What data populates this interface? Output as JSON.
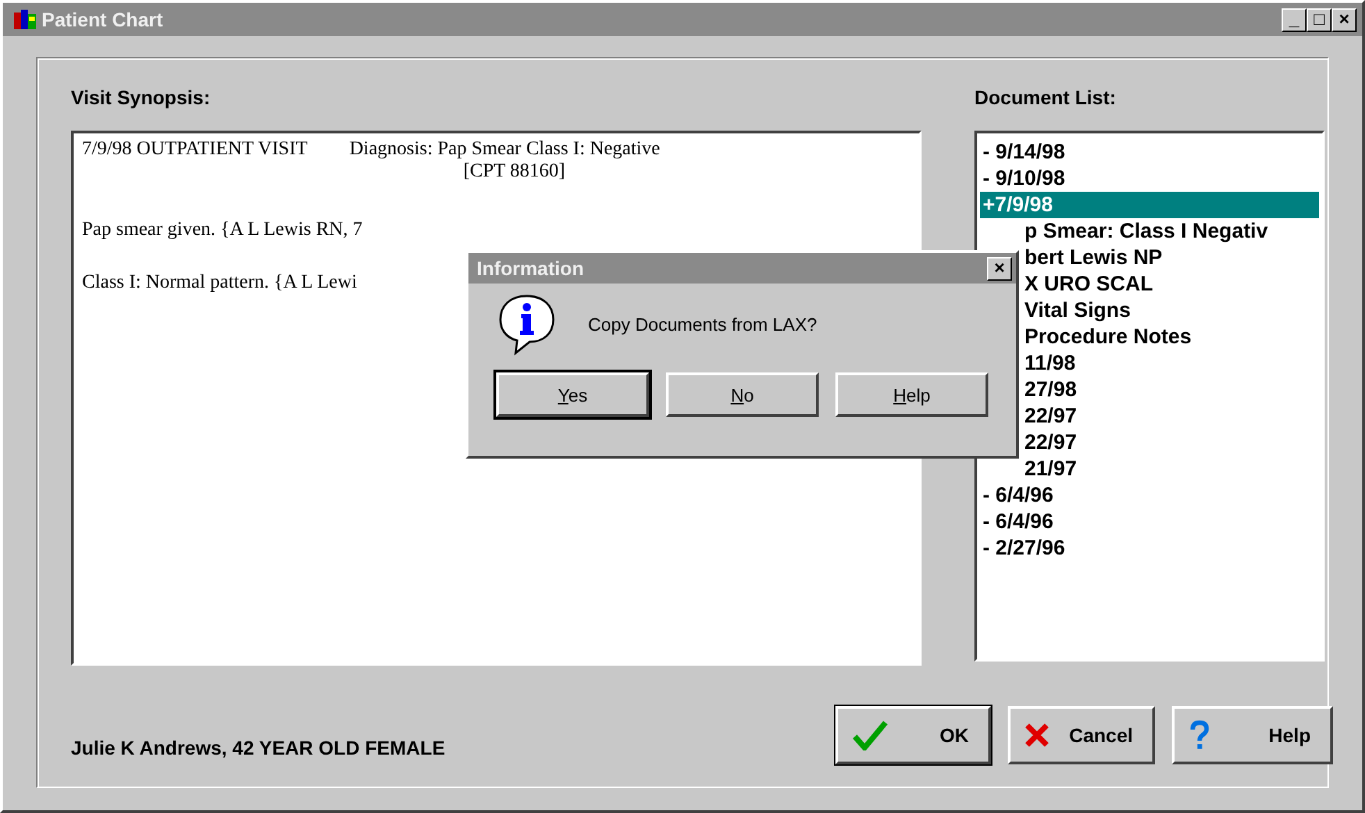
{
  "window": {
    "title": "Patient Chart",
    "controls": [
      "_",
      "□",
      "×"
    ]
  },
  "synopsis": {
    "label": "Visit Synopsis:",
    "lines": [
      {
        "kind": "header",
        "visit": "7/9/98 OUTPATIENT VISIT",
        "diagnosis": "Diagnosis:  Pap Smear Class I: Negative",
        "code": "[CPT 88160]"
      },
      {
        "kind": "text",
        "text": "Pap smear given.  {A L Lewis RN, 7"
      },
      {
        "kind": "text",
        "text": "Class I: Normal pattern.  {A L Lewi"
      }
    ]
  },
  "documents": {
    "label": "Document List:",
    "items": [
      {
        "text": "- 9/14/98",
        "selected": false,
        "covered": false
      },
      {
        "text": "- 9/10/98",
        "selected": false,
        "covered": false
      },
      {
        "text": "+7/9/98",
        "selected": true,
        "covered": false
      },
      {
        "text": "p Smear: Class I Negativ",
        "selected": false,
        "covered": true
      },
      {
        "text": "bert Lewis NP",
        "selected": false,
        "covered": true
      },
      {
        "text": "X URO SCAL",
        "selected": false,
        "covered": true
      },
      {
        "text": "Vital Signs",
        "selected": false,
        "covered": true
      },
      {
        "text": "Procedure Notes",
        "selected": false,
        "covered": true
      },
      {
        "text": "11/98",
        "selected": false,
        "covered": true
      },
      {
        "text": "27/98",
        "selected": false,
        "covered": true
      },
      {
        "text": "22/97",
        "selected": false,
        "covered": true
      },
      {
        "text": "22/97",
        "selected": false,
        "covered": true
      },
      {
        "text": "21/97",
        "selected": false,
        "covered": true
      },
      {
        "text": "- 6/4/96",
        "selected": false,
        "covered": false
      },
      {
        "text": "- 6/4/96",
        "selected": false,
        "covered": false
      },
      {
        "text": "- 2/27/96",
        "selected": false,
        "covered": false
      }
    ]
  },
  "patient": "Julie K Andrews, 42 YEAR OLD FEMALE",
  "buttons": [
    {
      "kind": "ok",
      "label": "OK",
      "default": true
    },
    {
      "kind": "cancel",
      "label": "Cancel",
      "default": false
    },
    {
      "kind": "help",
      "label": "Help",
      "default": false
    }
  ],
  "dialog": {
    "title": "Information",
    "close": "×",
    "message": "Copy Documents from LAX?",
    "buttons": [
      {
        "label": "Yes",
        "default": true
      },
      {
        "label": "No",
        "default": false
      },
      {
        "label": "Help",
        "default": false
      }
    ]
  }
}
